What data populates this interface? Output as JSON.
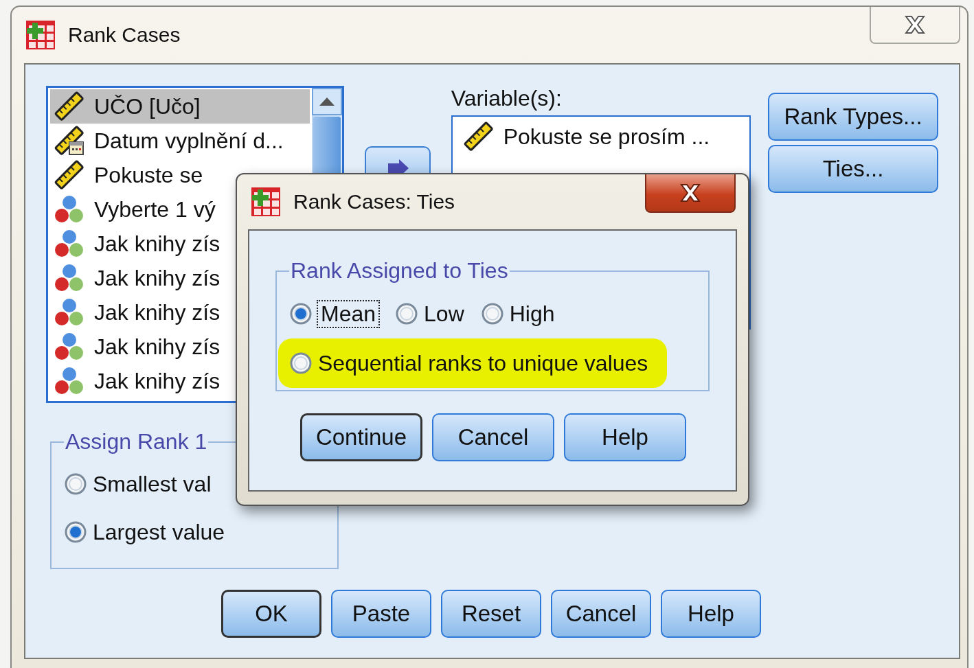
{
  "window": {
    "title": "Rank Cases"
  },
  "source_list": {
    "items": [
      {
        "label": "UČO [Učo]",
        "kind": "scale",
        "selected": true
      },
      {
        "label": "Datum vyplnění d...",
        "kind": "date",
        "selected": false
      },
      {
        "label": "Pokuste se",
        "kind": "scale",
        "selected": false
      },
      {
        "label": "Vyberte 1 vý",
        "kind": "nominal",
        "selected": false
      },
      {
        "label": "Jak knihy zís",
        "kind": "nominal",
        "selected": false
      },
      {
        "label": "Jak knihy zís",
        "kind": "nominal",
        "selected": false
      },
      {
        "label": "Jak knihy zís",
        "kind": "nominal",
        "selected": false
      },
      {
        "label": "Jak knihy zís",
        "kind": "nominal",
        "selected": false
      },
      {
        "label": "Jak knihy zís",
        "kind": "nominal",
        "selected": false
      }
    ]
  },
  "variables": {
    "label": "Variable(s):",
    "items": [
      {
        "label": "Pokuste se prosím ...",
        "kind": "scale"
      }
    ]
  },
  "side_buttons": [
    "Rank Types...",
    "Ties..."
  ],
  "assign_rank": {
    "title": "Assign Rank 1",
    "options": [
      {
        "label": "Smallest val",
        "selected": false
      },
      {
        "label": "Largest value",
        "selected": true
      }
    ]
  },
  "buttons": [
    {
      "label": "OK",
      "default": true
    },
    {
      "label": "Paste",
      "default": false
    },
    {
      "label": "Reset",
      "default": false
    },
    {
      "label": "Cancel",
      "default": false
    },
    {
      "label": "Help",
      "default": false
    }
  ],
  "ties_dialog": {
    "title": "Rank Cases: Ties",
    "group_title": "Rank Assigned to Ties",
    "rows": [
      {
        "options": [
          {
            "label": "Mean",
            "selected": true,
            "focused": true,
            "highlighted": false
          },
          {
            "label": "Low",
            "selected": false,
            "focused": false,
            "highlighted": false
          },
          {
            "label": "High",
            "selected": false,
            "focused": false,
            "highlighted": false
          }
        ]
      },
      {
        "options": [
          {
            "label": "Sequential ranks to unique values",
            "selected": false,
            "focused": false,
            "highlighted": true
          }
        ]
      }
    ],
    "buttons": [
      {
        "label": "Continue",
        "default": true
      },
      {
        "label": "Cancel",
        "default": false
      },
      {
        "label": "Help",
        "default": false
      }
    ]
  }
}
